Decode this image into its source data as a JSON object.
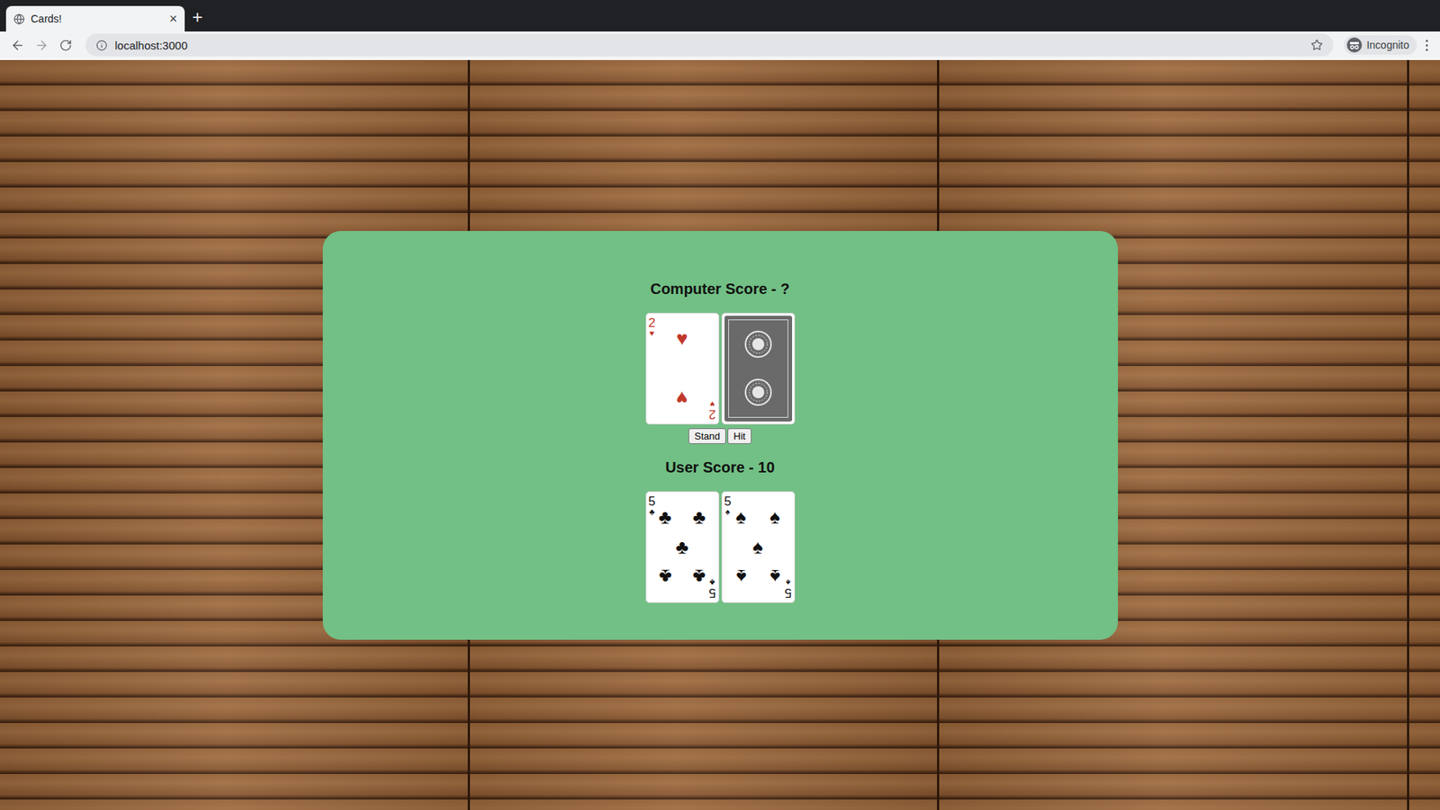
{
  "window": {
    "tab_title": "Cards!",
    "tab_close": "×",
    "new_tab": "+",
    "url": "localhost:3000",
    "profile": "Incognito"
  },
  "computer": {
    "label": "Computer Score - ?",
    "cards": [
      {
        "rank": "2",
        "suit": "♥",
        "color": "#c0392b",
        "face_down": false
      },
      {
        "face_down": true
      }
    ]
  },
  "buttons": [
    "Stand",
    "Hit"
  ],
  "user": {
    "label": "User Score - 10",
    "cards": [
      {
        "rank": "5",
        "suit": "♣",
        "color": "#111111",
        "face_down": false
      },
      {
        "rank": "5",
        "suit": "♠",
        "color": "#111111",
        "face_down": false
      }
    ]
  }
}
